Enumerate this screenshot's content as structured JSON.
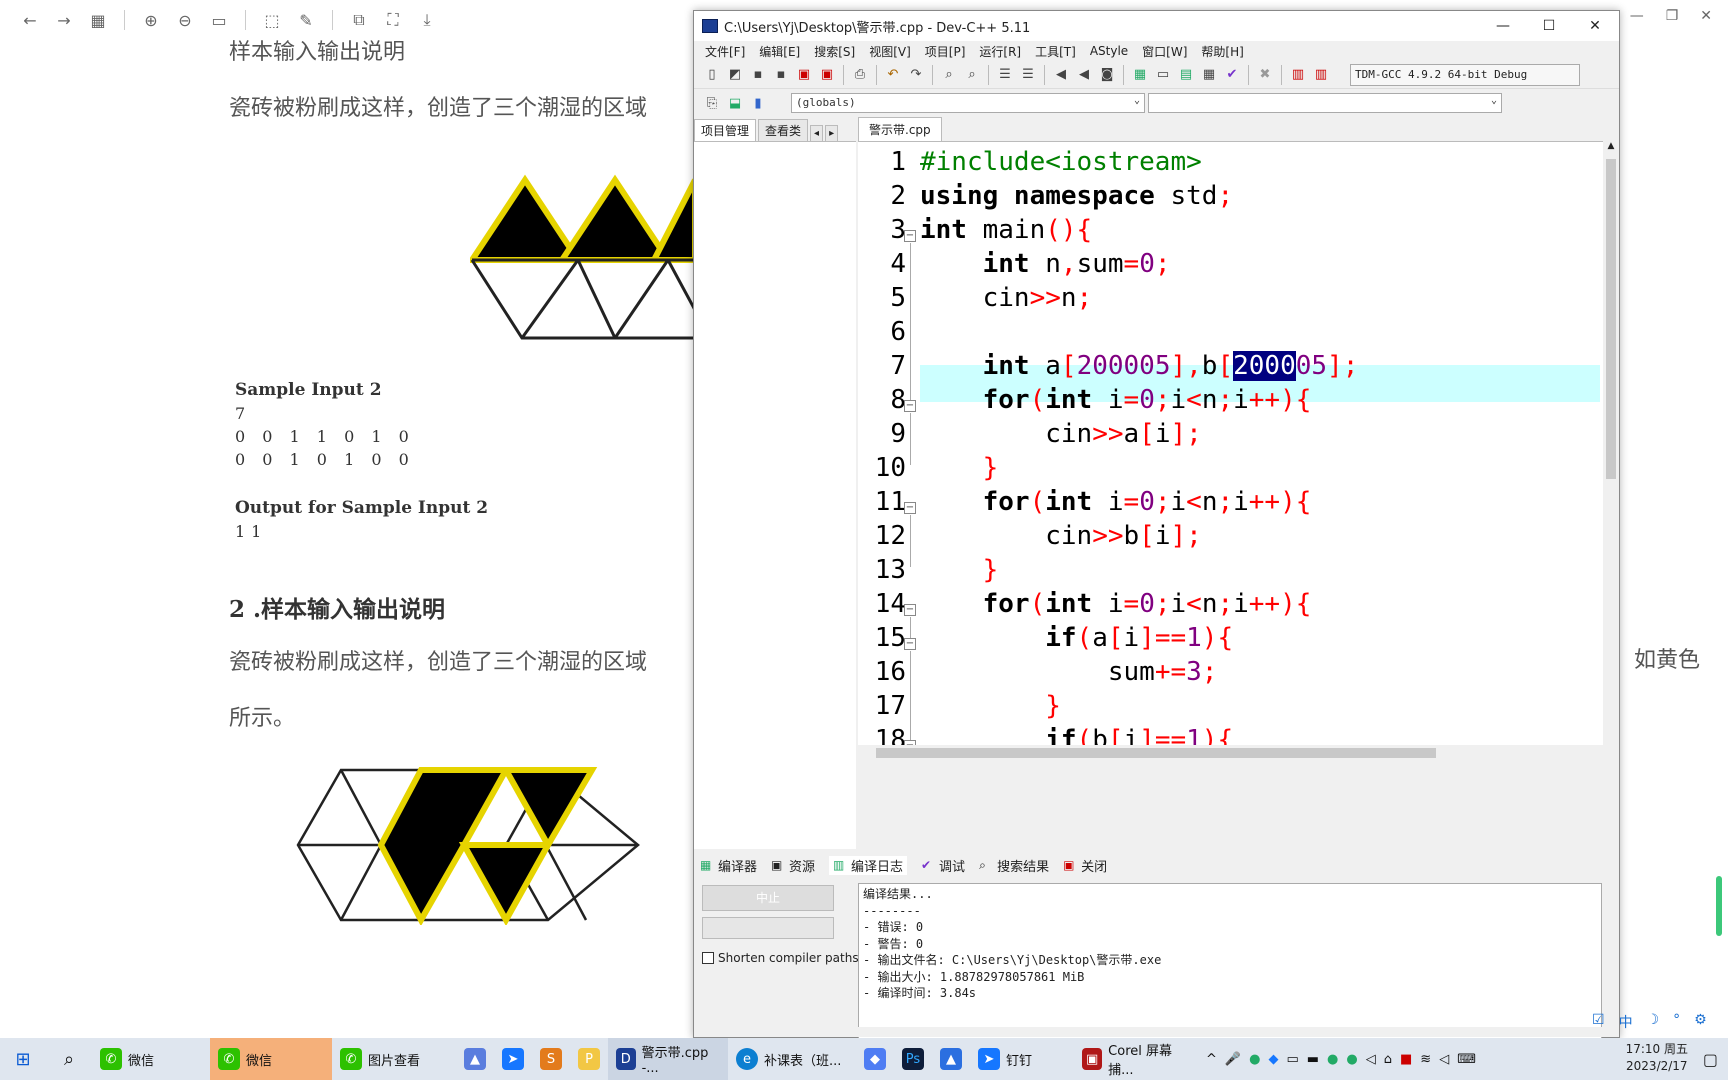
{
  "viewer": {
    "toolbar_icons": [
      "back-arrow-icon",
      "forward-arrow-icon",
      "grid-icon",
      "zoom-in-icon",
      "zoom-out-icon",
      "fit-icon",
      "rotate-icon",
      "edit-icon",
      "copy-icon",
      "fullscreen-icon",
      "download-icon"
    ],
    "heading_top": "样本输入输出说明",
    "para_top": "瓷砖被粉刷成这样，创造了三个潮湿的区域",
    "sample_input_label": "Sample Input 2",
    "sample_input_lines": [
      "7",
      "0 0 1 1 0 1 0",
      "0 0 1 0 1 0 0"
    ],
    "sample_output_label": "Output for Sample Input 2",
    "sample_output_value": "11",
    "section_heading": "2 .样本输入输出说明",
    "para_bottom": "瓷砖被粉刷成这样，创造了三个潮湿的区域",
    "para_bottom_end": "所示。",
    "right_fragment": "如黄色"
  },
  "devcpp": {
    "title": "C:\\Users\\Yj\\Desktop\\警示带.cpp - Dev-C++ 5.11",
    "menu": [
      "文件[F]",
      "编辑[E]",
      "搜索[S]",
      "视图[V]",
      "项目[P]",
      "运行[R]",
      "工具[T]",
      "AStyle",
      "窗口[W]",
      "帮助[H]"
    ],
    "compiler": "TDM-GCC 4.9.2 64-bit Debug",
    "scope_combo": "(globals)",
    "left_tabs": [
      "项目管理",
      "查看类"
    ],
    "file_tab": "警示带.cpp",
    "bottom_tabs": [
      "编译器",
      "资源",
      "编译日志",
      "调试",
      "搜索结果",
      "关闭"
    ],
    "abort_label": "中止",
    "shorten_label": "Shorten compiler paths",
    "log_lines": [
      "编译结果...",
      "--------",
      "- 错误: 0",
      "- 警告: 0",
      "- 输出文件名: C:\\Users\\Yj\\Desktop\\警示带.exe",
      "- 输出大小: 1.88782978057861 MiB",
      "- 编译时间: 3.84s"
    ],
    "line_numbers": [
      "1",
      "2",
      "3",
      "4",
      "5",
      "6",
      "7",
      "8",
      "9",
      "10",
      "11",
      "12",
      "13",
      "14",
      "15",
      "16",
      "17",
      "18"
    ]
  },
  "taskbar": {
    "items": [
      "微信",
      "微信",
      "图片查看",
      "",
      "",
      "",
      "",
      "警示带.cpp -...",
      "补课表（班...",
      "",
      "",
      "",
      "钉钉",
      "Corel 屏幕捕..."
    ],
    "time": "17:10 周五",
    "date": "2023/2/17",
    "ime": [
      "中",
      "☽"
    ]
  }
}
